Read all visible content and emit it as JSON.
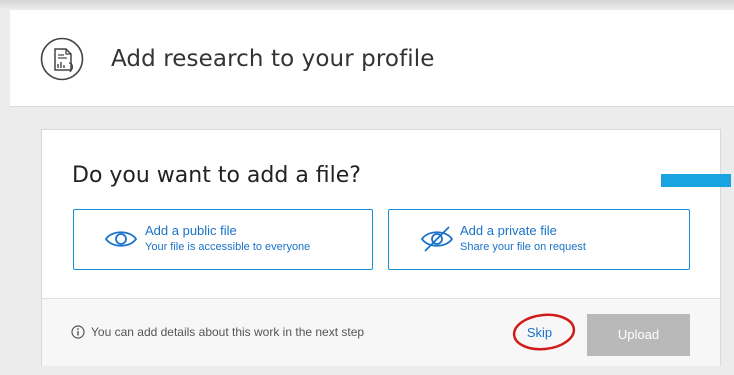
{
  "header": {
    "title": "Add research to your profile",
    "icon": "document-chart-icon"
  },
  "card": {
    "question": "Do you want to add a file?",
    "options": [
      {
        "title": "Add a public file",
        "subtitle": "Your file is accessible to everyone",
        "icon": "eye-icon"
      },
      {
        "title": "Add a private file",
        "subtitle": "Share your file on request",
        "icon": "eye-slash-icon"
      }
    ],
    "footer": {
      "info_icon": "info-icon",
      "info_text": "You can add details about this work in the next step",
      "skip_label": "Skip",
      "upload_label": "Upload"
    }
  },
  "colors": {
    "accent": "#1790d4",
    "accent_bar": "#19a3e0",
    "upload_disabled": "#b9b9b9",
    "skip_ring": "#d11a1a"
  }
}
